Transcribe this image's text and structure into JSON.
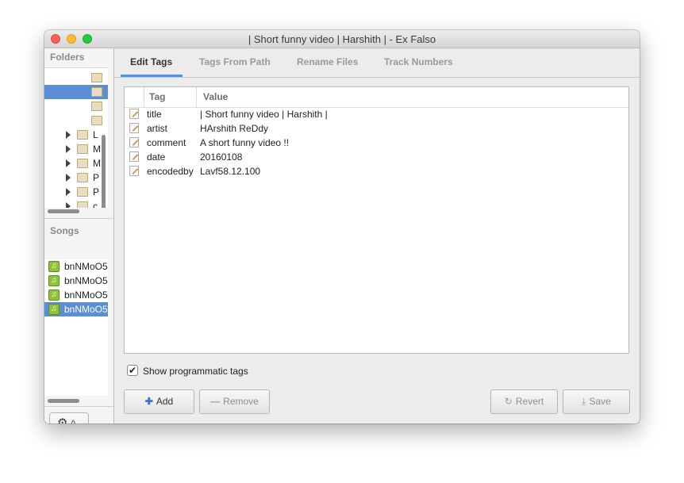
{
  "window": {
    "title": "| Short funny video | Harshith | - Ex Falso"
  },
  "folders": {
    "header": "Folders",
    "items": [
      {
        "label": "",
        "expandable": false,
        "selected": false
      },
      {
        "label": "",
        "expandable": false,
        "selected": true
      },
      {
        "label": "",
        "expandable": false,
        "selected": false
      },
      {
        "label": "",
        "expandable": false,
        "selected": false
      },
      {
        "label": "L",
        "expandable": true,
        "selected": false
      },
      {
        "label": "M",
        "expandable": true,
        "selected": false
      },
      {
        "label": "M",
        "expandable": true,
        "selected": false
      },
      {
        "label": "P",
        "expandable": true,
        "selected": false
      },
      {
        "label": "P",
        "expandable": true,
        "selected": false
      },
      {
        "label": "c",
        "expandable": true,
        "selected": false
      }
    ]
  },
  "songs": {
    "header": "Songs",
    "items": [
      {
        "label": "bnNMoO5",
        "selected": false
      },
      {
        "label": "bnNMoO5",
        "selected": false
      },
      {
        "label": "bnNMoO5",
        "selected": false
      },
      {
        "label": "bnNMoO5",
        "selected": true
      }
    ]
  },
  "bottom_left": {
    "gear_icon": "gear-icon",
    "more_label": "..."
  },
  "tabs": [
    {
      "label": "Edit Tags",
      "active": true
    },
    {
      "label": "Tags From Path",
      "active": false
    },
    {
      "label": "Rename Files",
      "active": false
    },
    {
      "label": "Track Numbers",
      "active": false
    }
  ],
  "tag_table": {
    "columns": [
      "Tag",
      "Value"
    ],
    "rows": [
      {
        "tag": "title",
        "value": "| Short funny video | Harshith |"
      },
      {
        "tag": "artist",
        "value": "HArshith ReDdy"
      },
      {
        "tag": "comment",
        "value": "A short funny video !!"
      },
      {
        "tag": "date",
        "value": "20160108"
      },
      {
        "tag": "encodedby",
        "value": "Lavf58.12.100"
      }
    ]
  },
  "show_programmatic": {
    "label": "Show programmatic tags",
    "checked": true
  },
  "buttons": {
    "add": "Add",
    "remove": "Remove",
    "revert": "Revert",
    "save": "Save"
  },
  "colors": {
    "selection": "#5b8fd5",
    "tab_active_underline": "#5b8fd5"
  }
}
